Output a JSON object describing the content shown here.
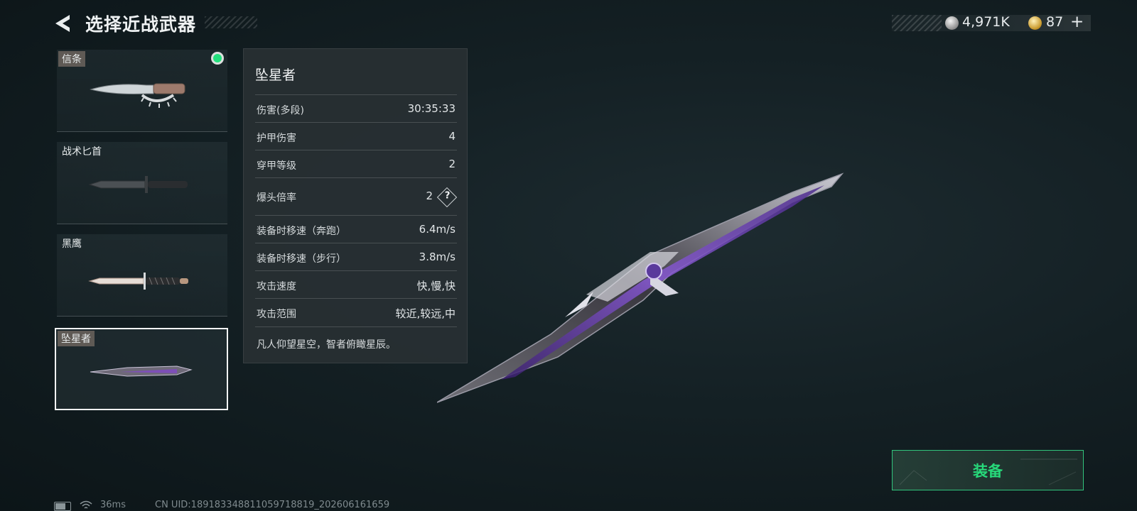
{
  "header": {
    "title": "选择近战武器",
    "silver_amount": "4,971K",
    "gold_amount": "87",
    "plus_label": "+"
  },
  "weapons": [
    {
      "name": "信条",
      "equipped": true,
      "tagged": true
    },
    {
      "name": "战术匕首",
      "equipped": false,
      "tagged": false
    },
    {
      "name": "黑鹰",
      "equipped": false,
      "tagged": false
    },
    {
      "name": "坠星者",
      "equipped": false,
      "tagged": true,
      "selected": true
    }
  ],
  "detail": {
    "title": "坠星者",
    "stats": [
      {
        "label": "伤害(多段)",
        "value": "30:35:33"
      },
      {
        "label": "护甲伤害",
        "value": "4"
      },
      {
        "label": "穿甲等级",
        "value": "2"
      },
      {
        "label": "爆头倍率",
        "value": "2",
        "help": "?"
      },
      {
        "label": "装备时移速（奔跑）",
        "value": "6.4m/s"
      },
      {
        "label": "装备时移速（步行）",
        "value": "3.8m/s"
      },
      {
        "label": "攻击速度",
        "value": "快,慢,快"
      },
      {
        "label": "攻击范围",
        "value": "较近,较远,中"
      }
    ],
    "description": "凡人仰望星空，智者俯瞰星辰。"
  },
  "equip_button": {
    "label": "装备"
  },
  "status": {
    "ping": "36ms",
    "uid": "CN UID:18918334881105971881​9_202606161659",
    "battery_level": 0.7
  },
  "colors": {
    "accent_green": "#27d97a",
    "equipped_dot": "#23e07d"
  }
}
